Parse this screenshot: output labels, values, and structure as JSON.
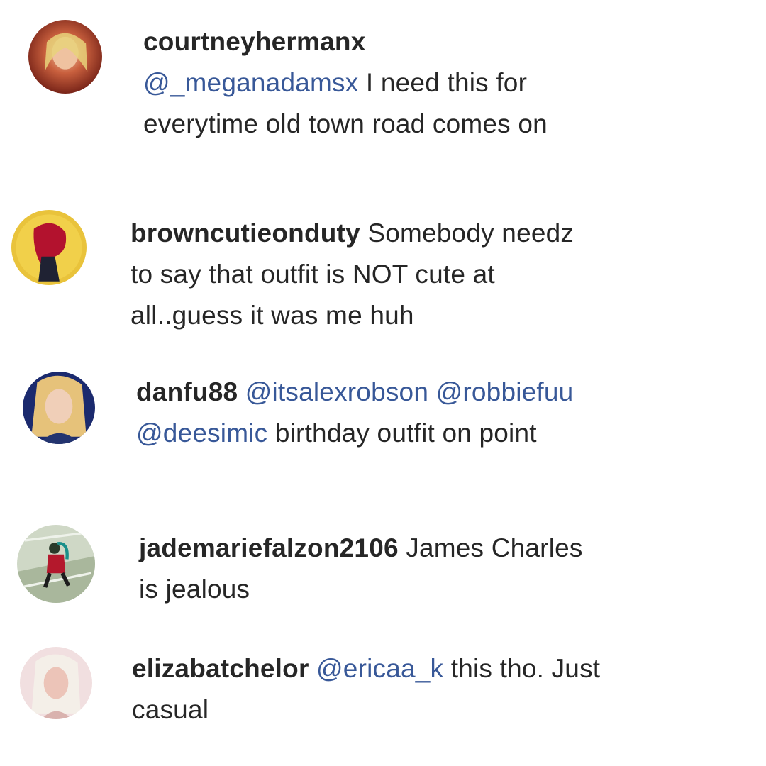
{
  "comments": [
    {
      "username": "courtneyhermanx",
      "mentions": [
        "@_meganadamsx"
      ],
      "text": "I need this for everytime old town road comes on",
      "avatar_icon": "user-avatar-icon"
    },
    {
      "username": "browncutieonduty",
      "mentions": [],
      "text": "Somebody needz to say that outfit is NOT cute at all..guess it was me huh",
      "avatar_icon": "user-avatar-icon"
    },
    {
      "username": "danfu88",
      "mentions": [
        "@itsalexrobson",
        "@robbiefuu",
        "@deesimic"
      ],
      "text": "birthday outfit on point",
      "avatar_icon": "user-avatar-icon"
    },
    {
      "username": "jademariefalzon2106",
      "mentions": [],
      "text": "James Charles is jealous",
      "avatar_icon": "user-avatar-icon"
    },
    {
      "username": "elizabatchelor",
      "mentions": [
        "@ericaa_k"
      ],
      "text": "this tho. Just casual",
      "avatar_icon": "user-avatar-icon"
    }
  ],
  "colors": {
    "text": "#262626",
    "mention": "#385898",
    "background": "#ffffff"
  }
}
